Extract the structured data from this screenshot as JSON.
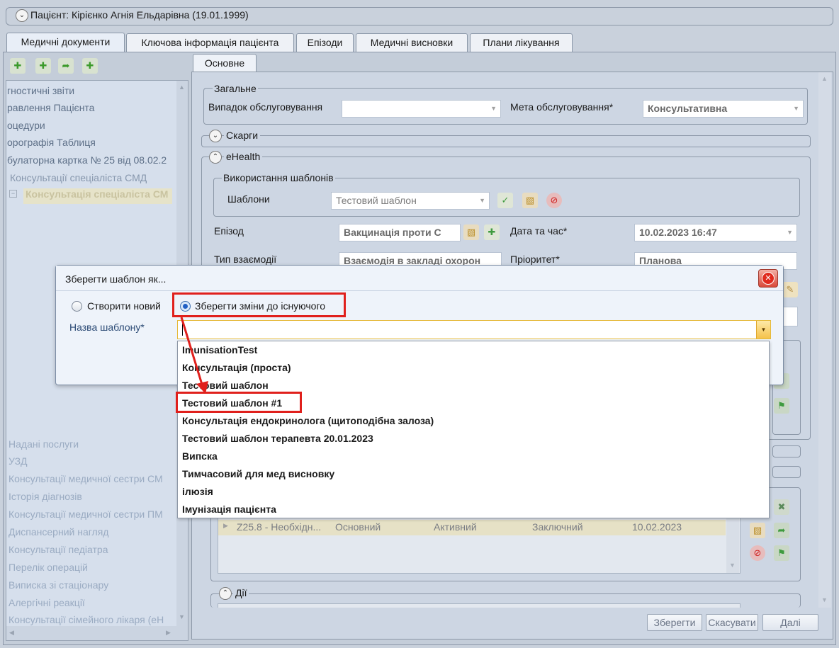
{
  "patient_header": {
    "title": "Пацієнт: Кірієнко Агнія Ельдарівна (19.01.1999)"
  },
  "main_tabs": [
    {
      "label": "Медичні документи"
    },
    {
      "label": "Ключова інформація пацієнта"
    },
    {
      "label": "Епізоди"
    },
    {
      "label": "Медичні висновки"
    },
    {
      "label": "Плани лікування"
    }
  ],
  "left_tree": {
    "items": [
      {
        "label": "гностичні звіти"
      },
      {
        "label": "равлення Пацієнта"
      },
      {
        "label": "оцедури"
      },
      {
        "label": "орографія Таблиця"
      },
      {
        "label": "булаторна картка № 25 від 08.02.2"
      },
      {
        "label": "Консультації спеціаліста СМД"
      },
      {
        "label": "Консультація спеціаліста СМ"
      },
      {
        "label": "Надані послуги"
      },
      {
        "label": "УЗД"
      },
      {
        "label": "Консультації медичної сестри СМ"
      },
      {
        "label": "Історія діагнозів"
      },
      {
        "label": "Консультації медичної сестри ПМ"
      },
      {
        "label": "Диспансерний нагляд"
      },
      {
        "label": "Консультації педіатра"
      },
      {
        "label": "Перелік операцій"
      },
      {
        "label": "Виписка зі стаціонару"
      },
      {
        "label": "Алергічні реакції"
      },
      {
        "label": "Консультації сімейного лікаря (еН"
      }
    ]
  },
  "inner_tab": {
    "label": "Основне"
  },
  "general": {
    "title": "Загальне",
    "case_label": "Випадок обслуговування",
    "case_value": "",
    "purpose_label": "Мета обслуговування*",
    "purpose_value": "Консультативна"
  },
  "complaints": {
    "title": "Скарги"
  },
  "ehealth": {
    "title": "eHealth",
    "templates_group": "Використання шаблонів",
    "templates_label": "Шаблони",
    "templates_value": "Тестовий шаблон",
    "episode_label": "Епізод",
    "episode_value": "Вакцинація проти С",
    "datetime_label": "Дата та час*",
    "datetime_value": "10.02.2023 16:47",
    "interaction_label": "Тип взаємодії",
    "interaction_value": "Взаємодія в закладі охорон",
    "priority_label": "Пріоритет*",
    "priority_value": "Планова"
  },
  "diagnosis_row": {
    "code": "Z25.8 - Необхідн...",
    "type": "Основний",
    "status": "Активний",
    "kind": "Заключний",
    "date": "10.02.2023"
  },
  "actions": {
    "title": "Дії"
  },
  "footer_buttons": {
    "save": "Зберегти",
    "cancel": "Скасувати",
    "next": "Далі"
  },
  "dialog": {
    "title": "Зберегти шаблон як...",
    "radio_new": "Створити новий",
    "radio_existing": "Зберегти зміни до існуючого",
    "name_label": "Назва шаблону*",
    "name_value": "",
    "options": [
      {
        "label": "ImunisationTest"
      },
      {
        "label": "Консультація (проста)"
      },
      {
        "label": "Тестовий шаблон"
      },
      {
        "label": "Тестовий шаблон #1"
      },
      {
        "label": "Консультація ендокринолога (щитоподібна залоза)"
      },
      {
        "label": "Тестовий шаблон терапевта 20.01.2023"
      },
      {
        "label": "Випска"
      },
      {
        "label": "Тимчасовий для мед висновку"
      },
      {
        "label": "ілюзія"
      },
      {
        "label": "Імунізація пацієнта"
      }
    ]
  },
  "colors": {
    "highlight_red": "#e0201c",
    "accent_blue": "#2a6fd1"
  }
}
